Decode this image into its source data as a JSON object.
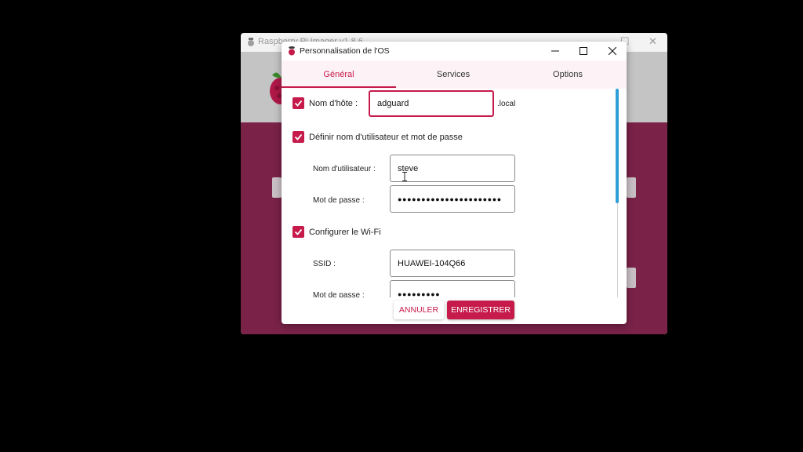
{
  "background_window": {
    "title": "Raspberry Pi Imager v1.8.6",
    "controls": [
      "—",
      "☐",
      "✕"
    ]
  },
  "dialog": {
    "title": "Personnalisation de l'OS",
    "controls": [
      "—",
      "☐",
      "✕"
    ],
    "tabs": [
      {
        "label": "Général",
        "active": true
      },
      {
        "label": "Services",
        "active": false
      },
      {
        "label": "Options",
        "active": false
      }
    ],
    "hostname": {
      "checked": true,
      "label": "Nom d'hôte :",
      "value": "adguard",
      "suffix": ".local"
    },
    "user": {
      "checked": true,
      "label": "Définir nom d'utilisateur et mot de passe",
      "username_label": "Nom d'utilisateur :",
      "username_value": "steve",
      "password_label": "Mot de passe :",
      "password_value": "●●●●●●●●●●●●●●●●●●●●●●"
    },
    "wifi": {
      "checked": true,
      "label": "Configurer le Wi-Fi",
      "ssid_label": "SSID :",
      "ssid_value": "HUAWEI-104Q66",
      "password_label": "Mot de passe :",
      "password_value": "●●●●●●●●●"
    },
    "buttons": {
      "cancel": "ANNULER",
      "save": "ENREGISTRER"
    }
  },
  "colors": {
    "accent": "#c51a4a",
    "scrollbar": "#2f9fd8",
    "background_band": "#7a2248"
  }
}
